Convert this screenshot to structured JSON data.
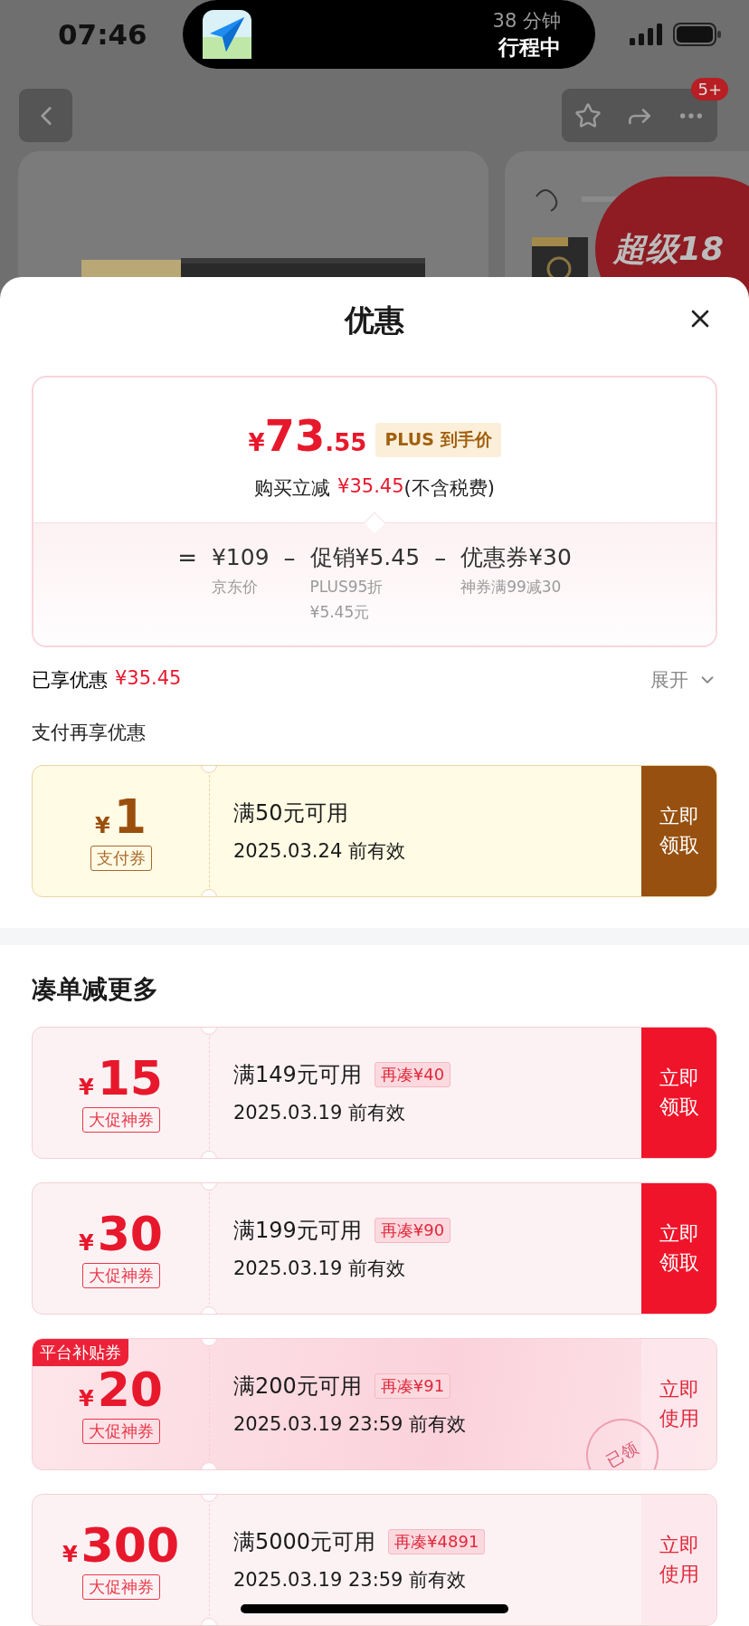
{
  "status_bar": {
    "time": "07:46",
    "activity": {
      "eta": "38 分钟",
      "status": "行程中"
    }
  },
  "nav": {
    "badge": "5+"
  },
  "background_cards": {
    "badge": "超级18"
  },
  "sheet": {
    "title": "优惠",
    "price_card": {
      "currency": "¥",
      "integer": "73",
      "decimal": ".55",
      "tag": "PLUS 到手价",
      "saving_label": "购买立减",
      "saving_amount": "¥35.45",
      "saving_note": "(不含税费)",
      "formula": [
        {
          "kind": "op",
          "text": "="
        },
        {
          "kind": "term",
          "value": "¥109",
          "notes": [
            "京东价"
          ]
        },
        {
          "kind": "op",
          "text": "–"
        },
        {
          "kind": "term",
          "value": "促销¥5.45",
          "notes": [
            "PLUS95折",
            "¥5.45元"
          ]
        },
        {
          "kind": "op",
          "text": "–"
        },
        {
          "kind": "term",
          "value": "优惠券¥30",
          "notes": [
            "神券满99减30"
          ]
        }
      ]
    },
    "enjoyed": {
      "label": "已享优惠",
      "amount": "¥35.45",
      "toggle": "展开",
      "expanded": false
    },
    "pay_section": {
      "title": "支付再享优惠",
      "coupons": [
        {
          "kind": "pay",
          "currency": "¥",
          "amount": "1",
          "tag": "支付券",
          "condition": "满50元可用",
          "expiry": "2025.03.24 前有效",
          "button": "立即领取",
          "claimed": false
        }
      ]
    },
    "more_section": {
      "title": "凑单减更多",
      "coupons": [
        {
          "kind": "promo",
          "currency": "¥",
          "amount": "15",
          "tag": "大促神券",
          "condition": "满149元可用",
          "topup": "再凑¥40",
          "expiry": "2025.03.19 前有效",
          "button": "立即领取",
          "claimed": false
        },
        {
          "kind": "promo",
          "currency": "¥",
          "amount": "30",
          "tag": "大促神券",
          "condition": "满199元可用",
          "topup": "再凑¥90",
          "expiry": "2025.03.19 前有效",
          "button": "立即领取",
          "claimed": false
        },
        {
          "kind": "subsidy",
          "corner": "平台补贴券",
          "currency": "¥",
          "amount": "20",
          "tag": "大促神券",
          "condition": "满200元可用",
          "topup": "再凑¥91",
          "expiry": "2025.03.19 23:59 前有效",
          "button": "立即使用",
          "claimed": true,
          "stamp": "已领"
        },
        {
          "kind": "promo",
          "currency": "¥",
          "amount": "300",
          "tag": "大促神券",
          "condition": "满5000元可用",
          "topup": "再凑¥4891",
          "expiry": "2025.03.19 23:59 前有效",
          "button": "立即使用",
          "claimed": true
        }
      ]
    }
  }
}
